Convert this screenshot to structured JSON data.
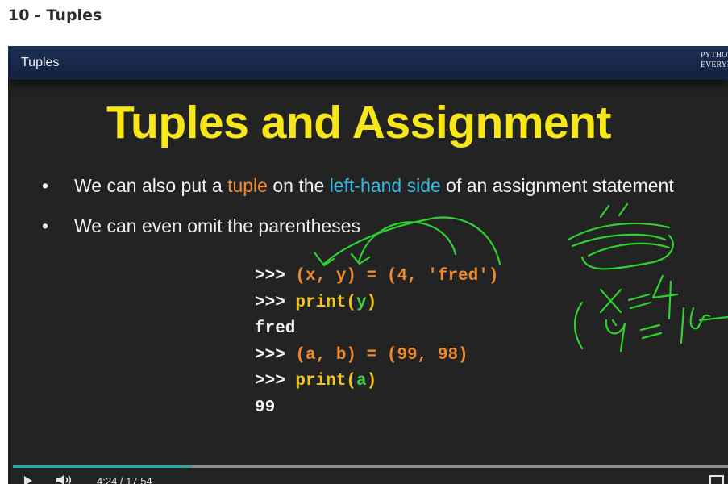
{
  "page": {
    "title": "10 - Tuples"
  },
  "slide": {
    "tab": "Tuples",
    "brand_line1": "PYTHON FOR",
    "brand_line2": "EVERYBODY",
    "title": "Tuples and Assignment",
    "bullets": [
      {
        "p1": "We can also put a ",
        "h1": "tuple",
        "p2": " on the ",
        "h2": "left-hand side",
        "p3": " of an assignment statement"
      },
      {
        "text": "We can even omit the parentheses"
      }
    ],
    "code": [
      {
        "prompt": ">>>",
        "rest": "(x, y) = (4, 'fred')"
      },
      {
        "prompt": ">>>",
        "fn": "print(",
        "arg": "y",
        "close": ")"
      },
      {
        "output": "fred"
      },
      {
        "prompt": ">>>",
        "rest": "(a, b) = (99, 98)"
      },
      {
        "prompt": ">>>",
        "fn": "print(",
        "arg": "a",
        "close": ")"
      },
      {
        "output": "99"
      }
    ]
  },
  "player": {
    "progress_fraction": 0.25,
    "time": "4:24 / 17:54",
    "colors": {
      "progress": "#2aa8a8",
      "annotation": "#2fd12f",
      "title": "#f6e61a"
    },
    "icons": [
      "play-icon",
      "volume-icon",
      "fullscreen-icon"
    ]
  }
}
